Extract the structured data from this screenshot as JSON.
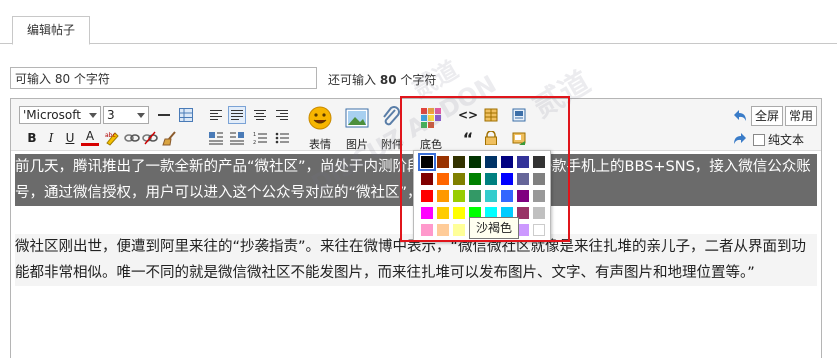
{
  "tabs": {
    "active_label": "编辑帖子"
  },
  "title_field": {
    "value": "可输入 80 个字符",
    "counter_prefix": "还可输入",
    "counter_number": "80",
    "counter_suffix": "个字符"
  },
  "toolbar": {
    "font_family": "'Microsoft",
    "font_size": "3",
    "bold": "B",
    "italic": "I",
    "underline": "U",
    "font_color": "A",
    "emoji_label": "表情",
    "image_label": "图片",
    "attach_label": "附件",
    "bgcolor_label": "底色",
    "code_symbol": "<>",
    "quote_symbol": "“",
    "fullscreen_label": "全屏",
    "common_label": "常用",
    "plaintext_label": "纯文本"
  },
  "content": {
    "para1": "前几天，腾讯推出了一款全新的产品“微社区”，尚处于内测阶段。简单来说，这是一款手机上的BBS+SNS，接入微信公众账号，通过微信授权，用户可以进入这个公众号对应的“微社区”，发帖、回帖和分享。",
    "para2": "微社区刚出世，便遭到阿里来往的“抄袭指责”。来往在微博中表示，“微信微社区就像是来往扎堆的亲儿子，二者从界面到功能都非常相似。唯一不同的就是微信微社区不能发图片，而来往扎堆可以发布图片、文字、有声图片和地理位置等。”"
  },
  "color_picker": {
    "tooltip": "沙褐色",
    "swatches": [
      [
        "#000000",
        "#993300",
        "#333300",
        "#003300",
        "#003366",
        "#000080",
        "#333399",
        "#333333"
      ],
      [
        "#800000",
        "#ff6600",
        "#808000",
        "#008000",
        "#008080",
        "#0000ff",
        "#666699",
        "#808080"
      ],
      [
        "#ff0000",
        "#ff9900",
        "#99cc00",
        "#339966",
        "#33cccc",
        "#3366ff",
        "#800080",
        "#999999"
      ],
      [
        "#ff00ff",
        "#ffcc00",
        "#ffff00",
        "#00ff00",
        "#00ffff",
        "#00ccff",
        "#993366",
        "#c0c0c0"
      ],
      [
        "#ff99cc",
        "#ffcc99",
        "#ffff99",
        "#ccffcc",
        "#ccffff",
        "#99ccff",
        "#cc99ff",
        "#ffffff"
      ]
    ]
  },
  "colors": {
    "highlight_box": "#e0151b",
    "selection_bg": "#6b6b6b"
  },
  "watermark": {
    "text": "DISCUZ 贰道 ADDON"
  }
}
